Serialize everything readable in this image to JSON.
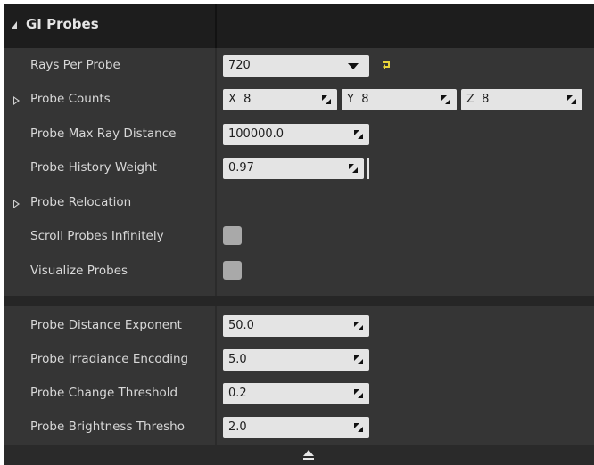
{
  "section": {
    "title": "GI Probes"
  },
  "rows": {
    "rays_per_probe": {
      "label": "Rays Per Probe",
      "value": "720"
    },
    "probe_counts": {
      "label": "Probe Counts",
      "x_axis": "X",
      "x": "8",
      "y_axis": "Y",
      "y": "8",
      "z_axis": "Z",
      "z": "8"
    },
    "probe_max_ray_distance": {
      "label": "Probe Max Ray Distance",
      "value": "100000.0"
    },
    "probe_history_weight": {
      "label": "Probe History Weight",
      "value": "0.97"
    },
    "probe_relocation": {
      "label": "Probe Relocation"
    },
    "scroll_probes_infinitely": {
      "label": "Scroll Probes Infinitely",
      "checked": false
    },
    "visualize_probes": {
      "label": "Visualize Probes",
      "checked": false
    },
    "probe_distance_exponent": {
      "label": "Probe Distance Exponent",
      "value": "50.0"
    },
    "probe_irradiance_encoding": {
      "label": "Probe Irradiance Encoding",
      "value": "5.0"
    },
    "probe_change_threshold": {
      "label": "Probe Change Threshold",
      "value": "0.2"
    },
    "probe_brightness_threshold": {
      "label": "Probe Brightness Thresho",
      "value": "2.0"
    }
  },
  "icons": {
    "reset": "reset-arrow-icon",
    "spin": "drag-spin-icon",
    "collapse": "collapse-triangle-icon",
    "eject": "eject-icon"
  },
  "colors": {
    "panel_bg": "#353535",
    "header_bg": "#1d1d1d",
    "field_bg": "#e4e4e4",
    "reset_accent": "#e8d43a",
    "checkbox_bg": "#a9a9a9"
  }
}
